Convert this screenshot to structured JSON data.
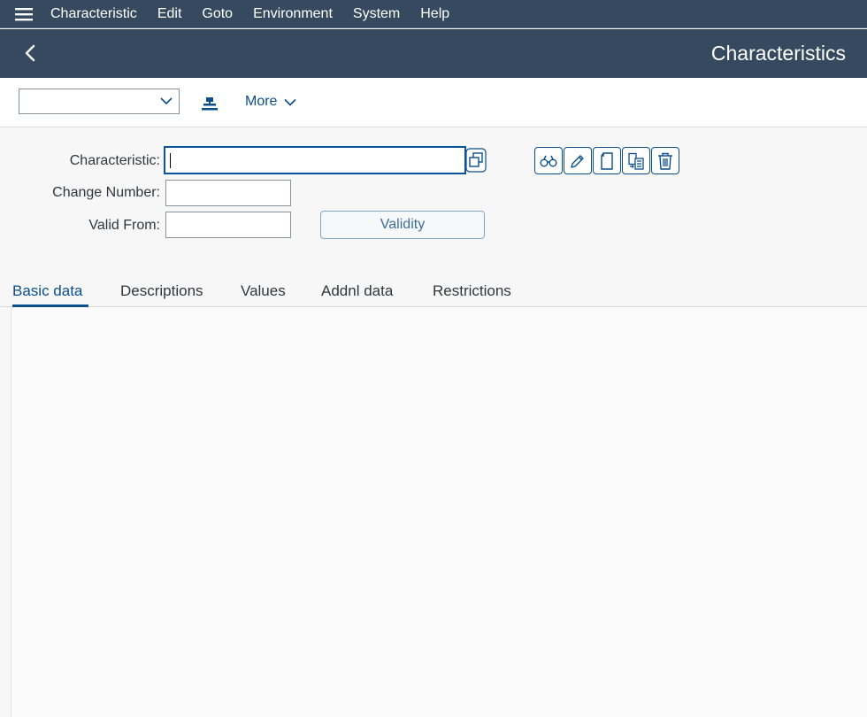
{
  "menu": {
    "items": [
      "Characteristic",
      "Edit",
      "Goto",
      "Environment",
      "System",
      "Help"
    ]
  },
  "header": {
    "title": "Characteristics"
  },
  "toolbar": {
    "dropdown_value": "",
    "more_label": "More"
  },
  "form": {
    "characteristic_label": "Characteristic:",
    "characteristic_value": "",
    "change_number_label": "Change Number:",
    "change_number_value": "",
    "valid_from_label": "Valid From:",
    "valid_from_value": "",
    "validity_button": "Validity"
  },
  "actions": [
    "display-icon",
    "edit-icon",
    "create-icon",
    "copy-from-icon",
    "delete-icon"
  ],
  "tabs": {
    "items": [
      "Basic data",
      "Descriptions",
      "Values",
      "Addnl data",
      "Restrictions"
    ],
    "active": "Basic data"
  },
  "colors": {
    "shell": "#354a5f",
    "accent": "#0a4e8c"
  }
}
